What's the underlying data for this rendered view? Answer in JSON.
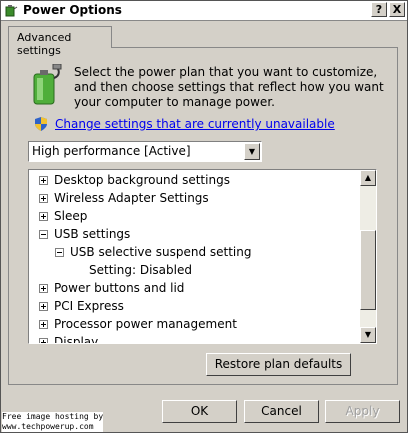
{
  "window": {
    "title": "Power Options",
    "help_button": "?",
    "close_button": "X"
  },
  "tab": {
    "label": "Advanced settings"
  },
  "description": "Select the power plan that you want to customize, and then choose settings that reflect how you want your computer to manage power.",
  "change_link": "Change settings that are currently unavailable",
  "plan_select": {
    "selected": "High performance [Active]"
  },
  "tree": [
    {
      "label": "Desktop background settings",
      "expander": "plus",
      "level": 0
    },
    {
      "label": "Wireless Adapter Settings",
      "expander": "plus",
      "level": 0
    },
    {
      "label": "Sleep",
      "expander": "plus",
      "level": 0
    },
    {
      "label": "USB settings",
      "expander": "minus",
      "level": 0
    },
    {
      "label": "USB selective suspend setting",
      "expander": "minus",
      "level": 1
    },
    {
      "label": "Setting:  Disabled",
      "expander": "none",
      "level": 2
    },
    {
      "label": "Power buttons and lid",
      "expander": "plus",
      "level": 0
    },
    {
      "label": "PCI Express",
      "expander": "plus",
      "level": 0
    },
    {
      "label": "Processor power management",
      "expander": "plus",
      "level": 0
    },
    {
      "label": "Display",
      "expander": "plus",
      "level": 0
    }
  ],
  "buttons": {
    "restore": "Restore plan defaults",
    "ok": "OK",
    "cancel": "Cancel",
    "apply": "Apply"
  },
  "watermark": {
    "line1": "Free image hosting by",
    "line2": "www.techpowerup.com"
  },
  "icons": {
    "app": "power-options-icon",
    "battery": "battery-plug-icon",
    "shield": "uac-shield-icon"
  }
}
